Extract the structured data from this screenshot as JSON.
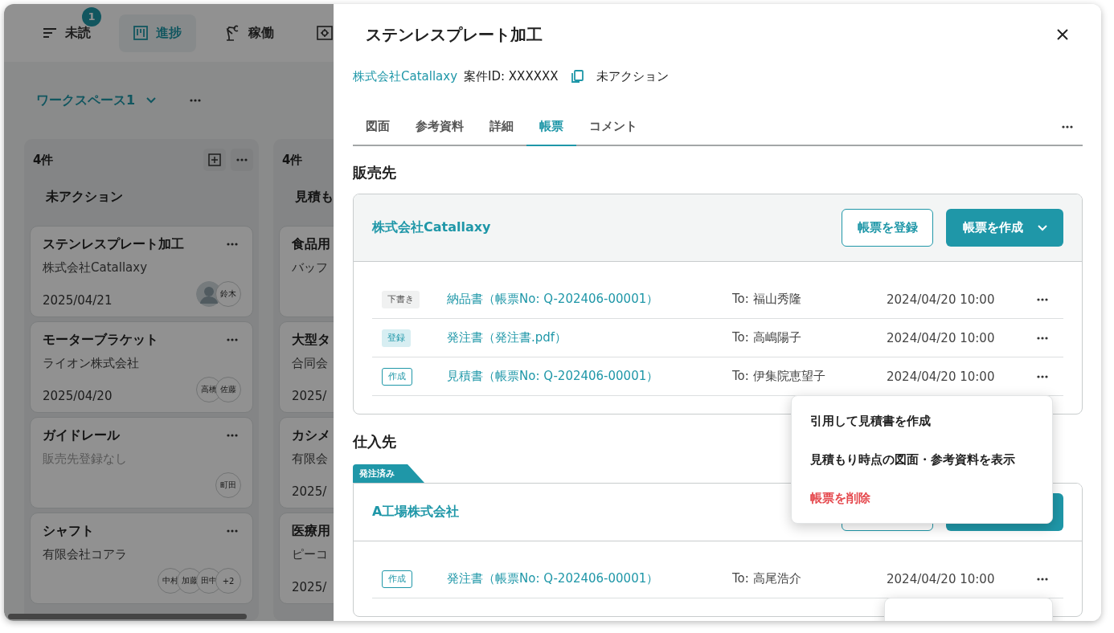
{
  "nav": {
    "items": [
      {
        "label": "未読",
        "badge": "1",
        "selected": false
      },
      {
        "label": "進捗",
        "selected": true
      },
      {
        "label": "稼働",
        "selected": false
      },
      {
        "selected": false
      }
    ]
  },
  "workspace": {
    "name": "ワークスペース1"
  },
  "board": {
    "columns": [
      {
        "count": "4件",
        "status": "未アクション",
        "partial": false,
        "cards": [
          {
            "title": "ステンレスプレート加工",
            "customer": "株式会社Catallaxy",
            "date": "2025/04/21",
            "assignees": [
              {
                "kind": "picture"
              },
              {
                "kind": "initials",
                "name": "鈴木"
              }
            ]
          },
          {
            "title": "モーターブラケット",
            "customer": "ライオン株式会社",
            "date": "2025/04/20",
            "assignees": [
              {
                "kind": "initials",
                "name": "高橋"
              },
              {
                "kind": "initials",
                "name": "佐藤"
              }
            ]
          },
          {
            "title": "ガイドレール",
            "customer": "販売先登録なし",
            "customer_missing": true,
            "assignees": [
              {
                "kind": "initials",
                "name": "町田"
              }
            ]
          },
          {
            "title": "シャフト",
            "customer": "有限会社コアラ",
            "assignees": [
              {
                "kind": "initials",
                "name": "中村"
              },
              {
                "kind": "initials",
                "name": "加藤"
              },
              {
                "kind": "initials",
                "name": "田中"
              },
              {
                "kind": "initials",
                "name": "+2"
              }
            ]
          }
        ]
      },
      {
        "count": "4件",
        "status": "見積も",
        "partial": true,
        "cards": [
          {
            "title": "食品用",
            "customer": "バッフ"
          },
          {
            "title": "大型タ",
            "customer": "合同会",
            "date": "2025/"
          },
          {
            "title": "カシメ",
            "customer": "有限会",
            "date": "2025/"
          },
          {
            "title": "医療用",
            "customer": "ピーコ",
            "date": "2025/"
          }
        ]
      }
    ]
  },
  "drawer": {
    "title": "ステンレスプレート加工",
    "company": "株式会社Catallaxy",
    "case_id": "案件ID: XXXXXX",
    "status": "未アクション",
    "tabs": [
      {
        "label": "図面",
        "selected": false
      },
      {
        "label": "参考資料",
        "selected": false
      },
      {
        "label": "詳細",
        "selected": false
      },
      {
        "label": "帳票",
        "selected": true
      },
      {
        "label": "コメント",
        "selected": false
      }
    ],
    "sections": [
      {
        "title": "販売先",
        "company": "株式会社Catallaxy",
        "buttons": [
          "帳票を登録",
          "帳票を作成"
        ],
        "documents": [
          {
            "tag": "下書き",
            "kind": "draft",
            "name": "納品書（帳票No: Q-202406-00001）",
            "to": "To: 福山秀隆",
            "date": "2024/04/20 10:00"
          },
          {
            "tag": "登録",
            "kind": "registered",
            "name": "発注書（発注書.pdf）",
            "to": "To: 高嶋陽子",
            "date": "2024/04/20 10:00"
          },
          {
            "tag": "作成",
            "kind": "created",
            "name": "見積書（帳票No: Q-202406-00001）",
            "to": "To: 伊集院恵望子",
            "date": "2024/04/20 10:00"
          }
        ]
      },
      {
        "title": "仕入先",
        "ribbon": "発注済み",
        "company": "A工場株式会社",
        "documents": [
          {
            "tag": "作成",
            "kind": "created",
            "name": "発注書（帳票No: Q-202406-00001）",
            "to": "To: 高尾浩介",
            "date": "2024/04/20 10:00"
          }
        ]
      }
    ],
    "menus": [
      {
        "items": [
          {
            "label": "引用して見積書を作成",
            "kind": "normal"
          },
          {
            "label": "見積もり時点の図面・参考資料を表示",
            "kind": "normal"
          },
          {
            "label": "帳票を削除",
            "kind": "danger"
          }
        ]
      }
    ]
  }
}
